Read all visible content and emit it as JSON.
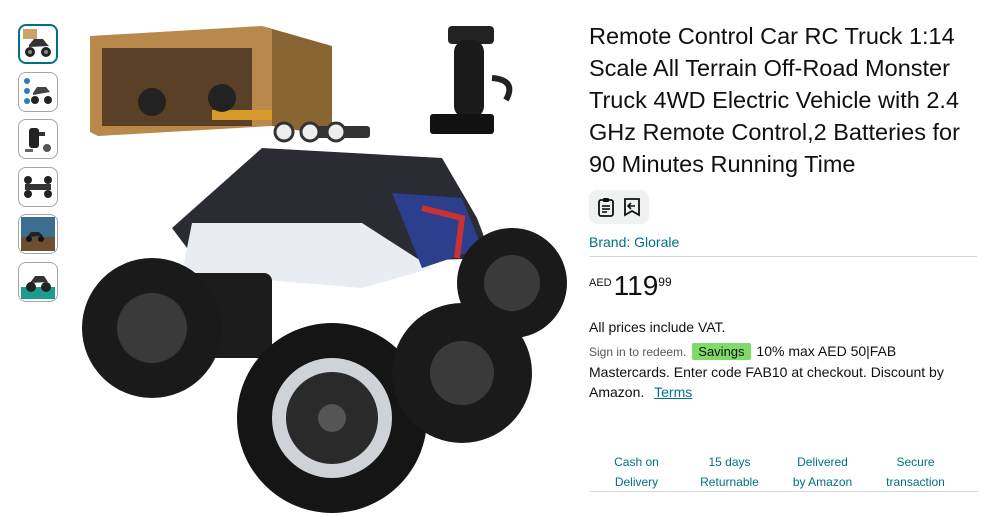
{
  "product": {
    "title": "Remote Control Car RC Truck 1:14 Scale All Terrain Off-Road Monster Truck 4WD Electric Vehicle with 2.4 GHz Remote Control,2 Batteries for 90 Minutes Running Time",
    "brand": "Brand: Glorale",
    "price": {
      "currency": "AED",
      "whole": "119",
      "fraction": "99"
    },
    "vat_note": "All prices include VAT."
  },
  "promo": {
    "signin": "Sign in to redeem.",
    "badge": "Savings",
    "text": "10% max AED 50|FAB Mastercards. Enter code FAB10 at checkout. Discount by Amazon.",
    "terms": "Terms"
  },
  "features": [
    {
      "line1": "Cash on",
      "line2": "Delivery"
    },
    {
      "line1": "15 days",
      "line2": "Returnable"
    },
    {
      "line1": "Delivered",
      "line2": "by Amazon"
    },
    {
      "line1": "Secure",
      "line2": "transaction"
    }
  ],
  "icons": [
    "clipboard-icon",
    "share-icon"
  ],
  "colors": {
    "link": "#007185",
    "badge": "#7fda69",
    "selected_border": "#007185"
  }
}
